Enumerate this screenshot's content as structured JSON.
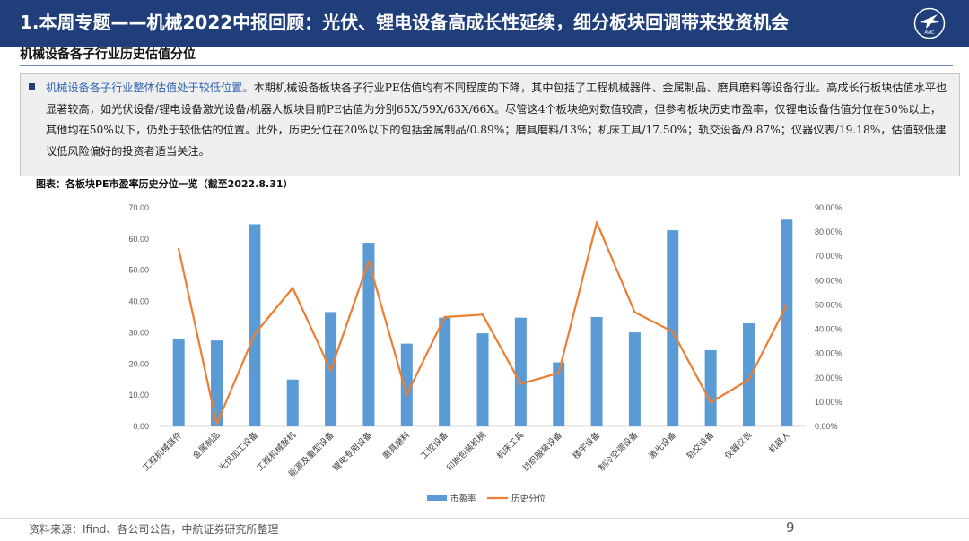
{
  "header": {
    "title": "1.本周专题——机械2022中报回顾：光伏、锂电设备高成长性延续，细分板块回调带来投资机会",
    "logo_text": "AVIC"
  },
  "subtitle": "机械设备各子行业历史估值分位",
  "summary": {
    "highlight": "机械设备各子行业整体估值处于较低位置。",
    "body": "本期机械设备板块各子行业PE估值均有不同程度的下降，其中包括了工程机械器件、金属制品、磨具磨料等设备行业。高成长行板块估值水平也显著较高，如光伏设备/锂电设备激光设备/机器人板块目前PE估值为分别65X/59X/63X/66X。尽管这4个板块绝对数值较高，但参考板块历史市盈率，仅锂电设备估值分位在50%以上，其他均在50%以下，仍处于较低估的位置。此外，历史分位在20%以下的包括金属制品/0.89%；磨具磨料/13%；机床工具/17.50%；轨交设备/9.87%；仪器仪表/19.18%，估值较低建议低风险偏好的投资者适当关注。"
  },
  "figure_title": "图表：各板块PE市盈率历史分位一览（截至2022.8.31）",
  "footer": {
    "source": "资料来源：Ifind、各公司公告，中航证券研究所整理",
    "page": "9"
  },
  "colors": {
    "bar": "#5b9bd5",
    "line": "#ed7d31",
    "header": "#1f3e7a"
  },
  "chart_data": {
    "type": "bar+line",
    "categories": [
      "工程机械器件",
      "金属制品",
      "光伏加工设备",
      "工程机械整机",
      "能源及重型设备",
      "锂电专用设备",
      "磨具磨料",
      "工控设备",
      "印刷包装机械",
      "机床工具",
      "纺织服装设备",
      "楼宇设备",
      "制冷空调设备",
      "激光设备",
      "轨交设备",
      "仪器仪表",
      "机器人"
    ],
    "series": [
      {
        "name": "市盈率",
        "type": "bar",
        "axis": "left",
        "values": [
          28.0,
          27.5,
          64.7,
          15.0,
          36.6,
          58.8,
          26.5,
          34.8,
          29.8,
          34.8,
          20.5,
          35.0,
          30.1,
          62.8,
          24.4,
          33.0,
          66.2
        ]
      },
      {
        "name": "历史分位",
        "type": "line",
        "axis": "right",
        "values": [
          0.73,
          0.0089,
          0.38,
          0.57,
          0.23,
          0.68,
          0.13,
          0.45,
          0.46,
          0.175,
          0.22,
          0.84,
          0.47,
          0.39,
          0.0987,
          0.1918,
          0.5
        ]
      }
    ],
    "left_axis": {
      "min": 0,
      "max": 70,
      "ticks": [
        "0.00",
        "10.00",
        "20.00",
        "30.00",
        "40.00",
        "50.00",
        "60.00",
        "70.00"
      ]
    },
    "right_axis": {
      "min": 0,
      "max": 0.9,
      "ticks": [
        "0.00%",
        "10.00%",
        "20.00%",
        "30.00%",
        "40.00%",
        "50.00%",
        "60.00%",
        "70.00%",
        "80.00%",
        "90.00%"
      ]
    },
    "legend_position": "bottom",
    "grid": false
  }
}
